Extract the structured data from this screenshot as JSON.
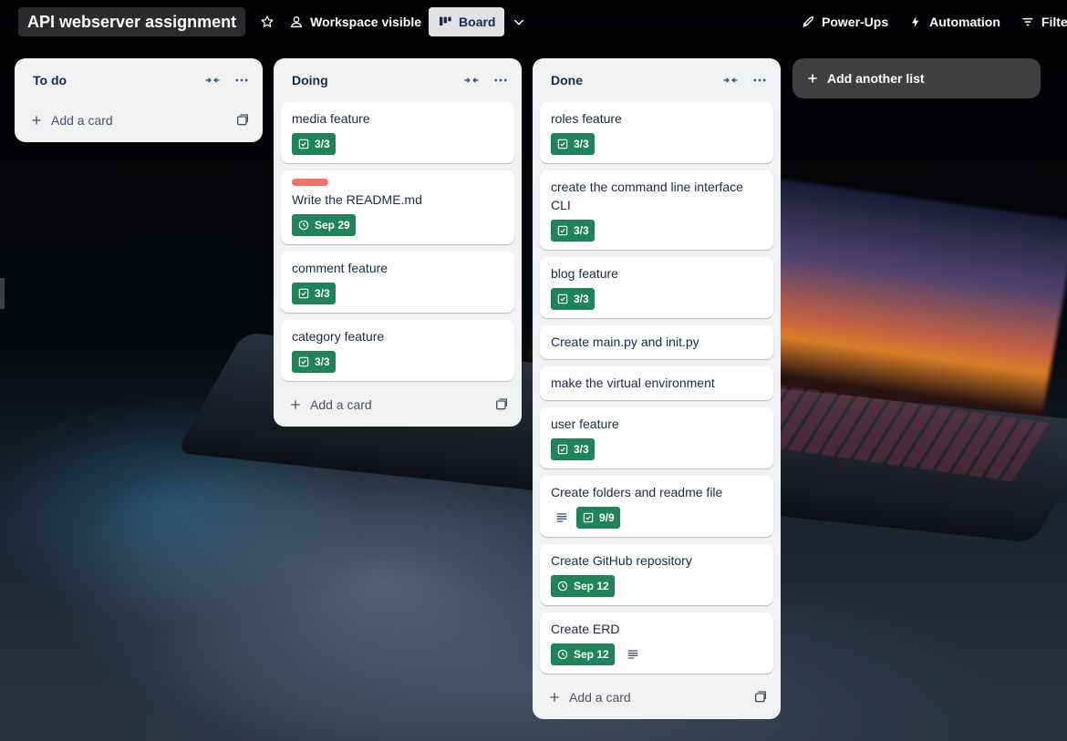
{
  "header": {
    "board_title": "API webserver assignment",
    "workspace_label": "Workspace visible",
    "board_view_label": "Board",
    "powerups_label": "Power-Ups",
    "automation_label": "Automation",
    "filter_label": "Filte"
  },
  "lists": [
    {
      "title": "To do",
      "add_card_label": "Add a card",
      "cards": []
    },
    {
      "title": "Doing",
      "add_card_label": "Add a card",
      "cards": [
        {
          "title": "media feature",
          "checklist": "3/3"
        },
        {
          "title": "Write the README.md",
          "label_color": "#f87168",
          "due": "Sep 29"
        },
        {
          "title": "comment feature",
          "checklist": "3/3"
        },
        {
          "title": "category feature",
          "checklist": "3/3"
        }
      ]
    },
    {
      "title": "Done",
      "add_card_label": "Add a card",
      "cards": [
        {
          "title": "roles feature",
          "checklist": "3/3"
        },
        {
          "title": "create the command line interface CLI",
          "checklist": "3/3"
        },
        {
          "title": "blog feature",
          "checklist": "3/3"
        },
        {
          "title": "Create main.py and init.py"
        },
        {
          "title": "make the virtual environment"
        },
        {
          "title": "user feature",
          "checklist": "3/3"
        },
        {
          "title": "Create folders and readme file",
          "description": true,
          "checklist": "9/9"
        },
        {
          "title": "Create GitHub repository",
          "due": "Sep 12"
        },
        {
          "title": "Create ERD",
          "due": "Sep 12",
          "description_after": true
        }
      ]
    }
  ],
  "add_list_label": "Add another list",
  "colors": {
    "badge_green": "#1f845a",
    "list_bg": "#f1f2f4",
    "label_red": "#f87168"
  }
}
